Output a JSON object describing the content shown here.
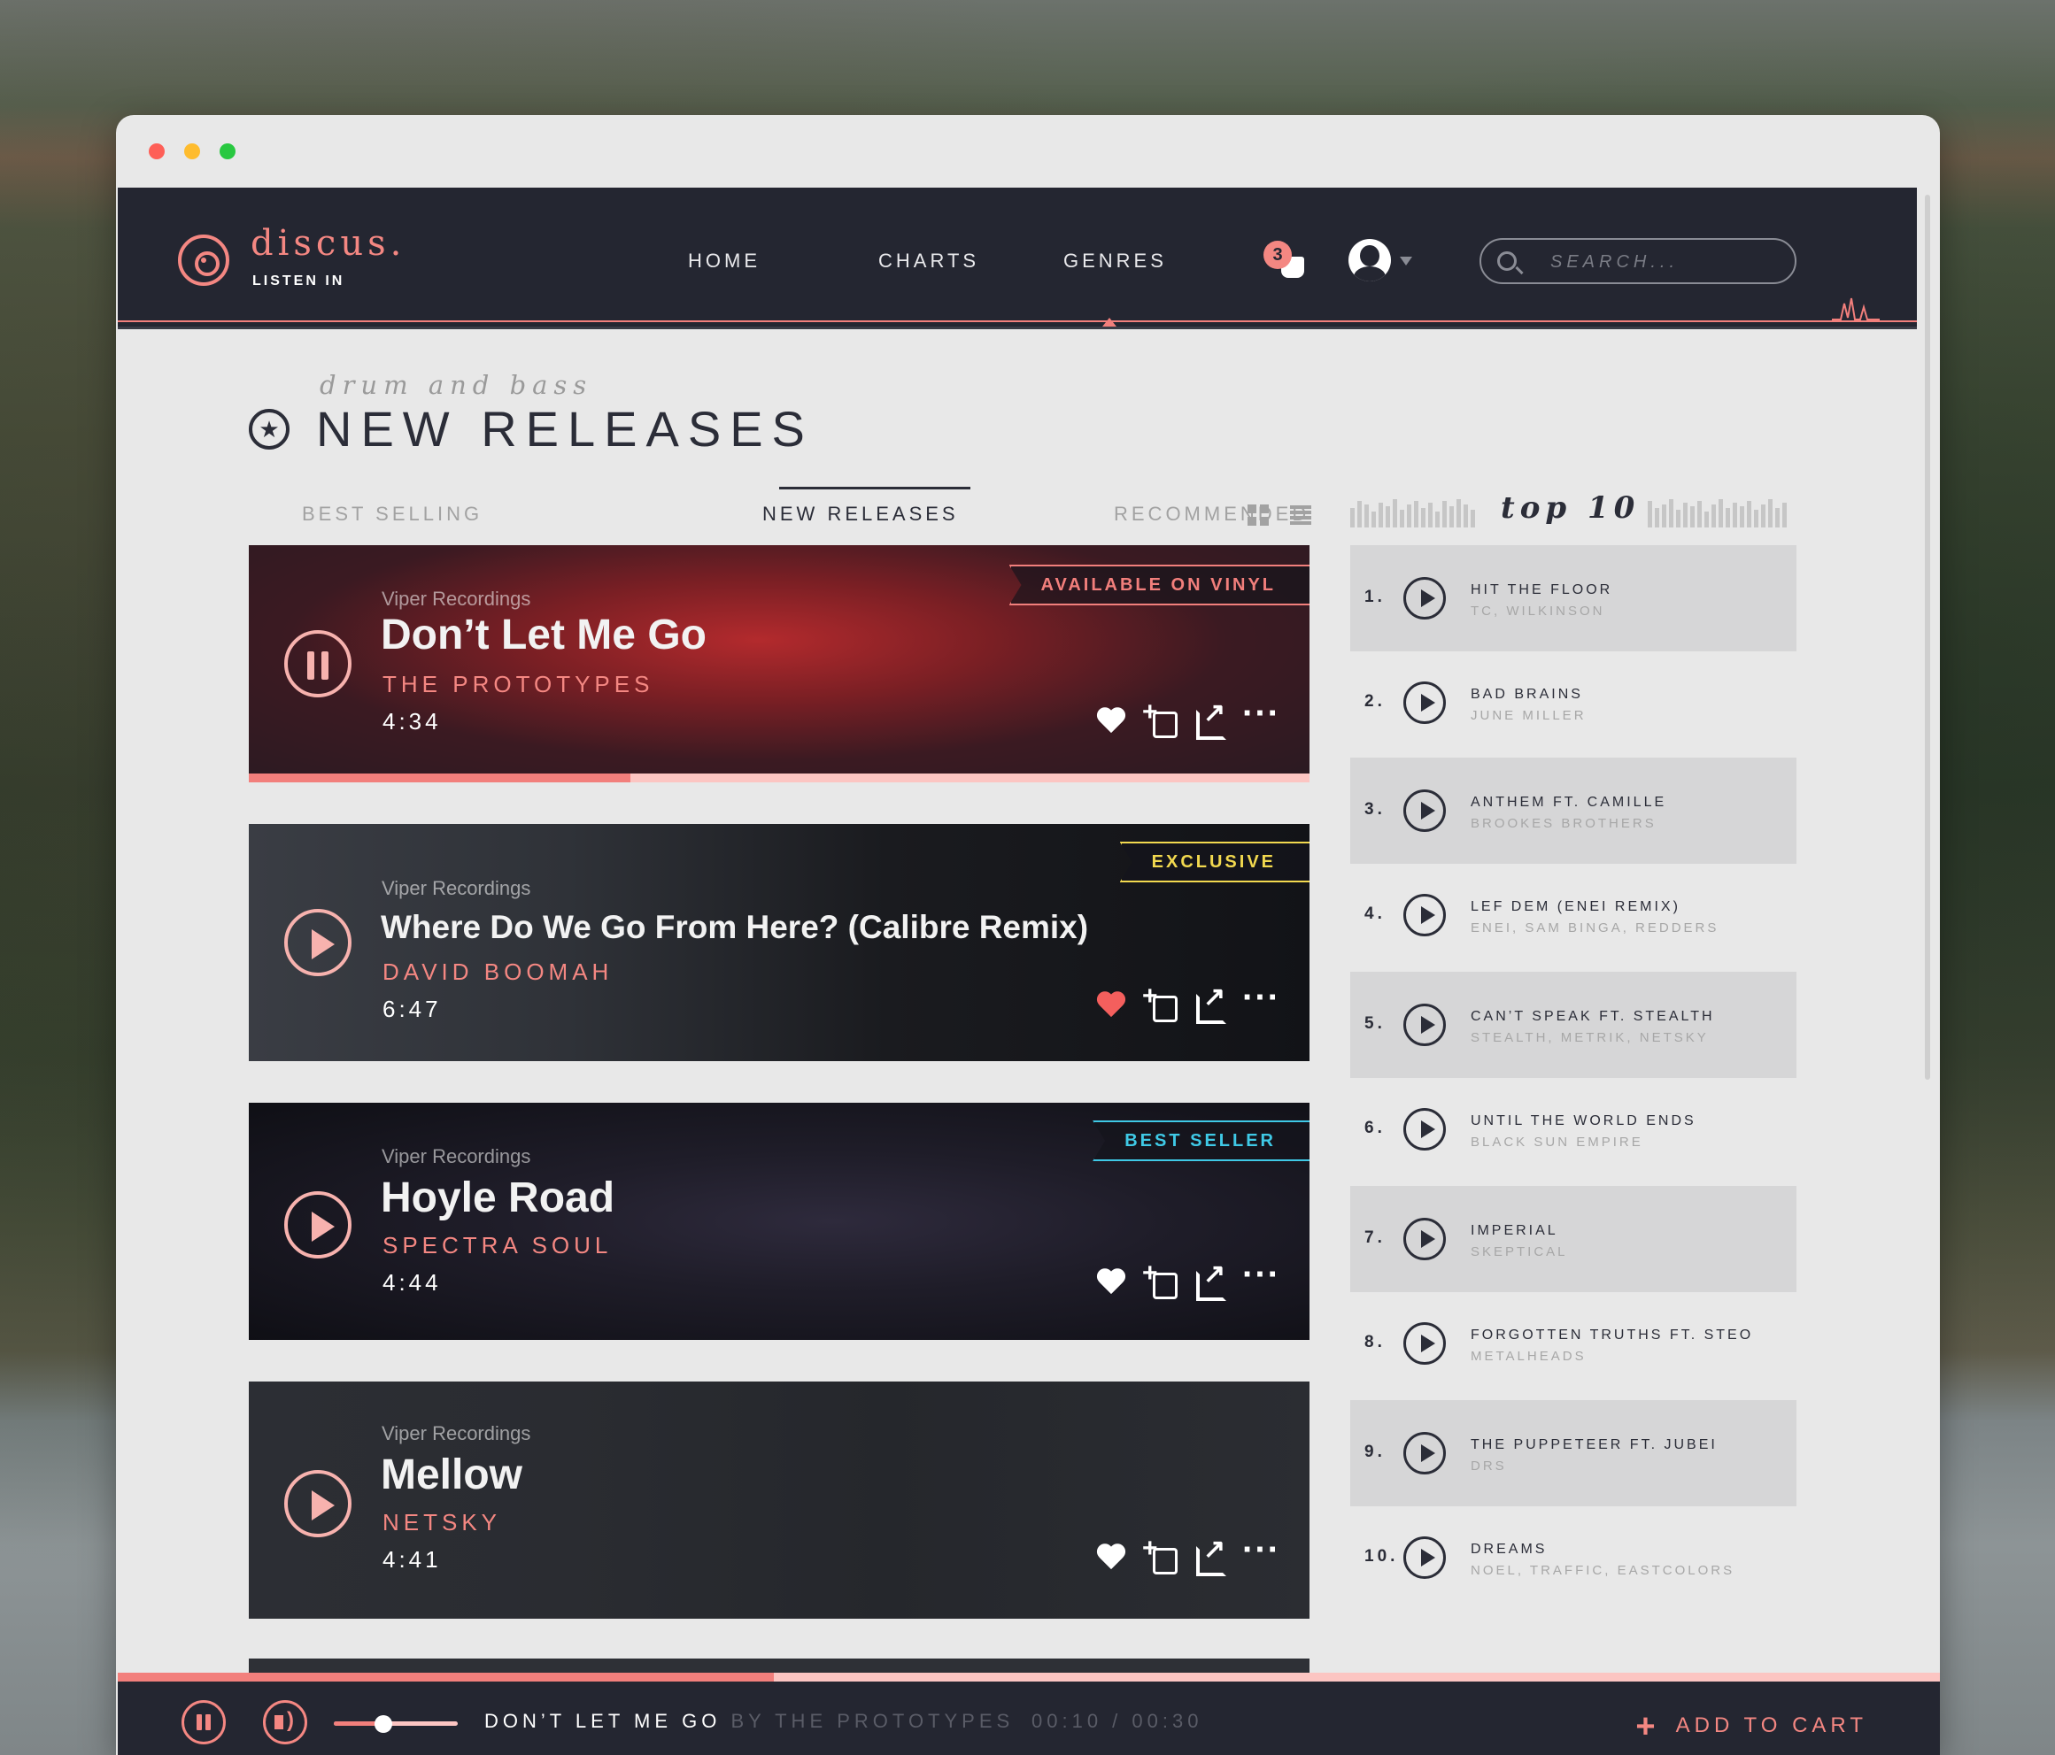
{
  "brand": {
    "name": "discus.",
    "tagline": "LISTEN IN",
    "accent": "#f48782",
    "dark": "#242631"
  },
  "nav": {
    "items": [
      "HOME",
      "CHARTS",
      "GENRES"
    ],
    "active": "GENRES"
  },
  "notifications": {
    "count": "3"
  },
  "search": {
    "placeholder": "SEARCH..."
  },
  "page": {
    "subtitle": "drum and bass",
    "title": "NEW RELEASES"
  },
  "tabs": [
    "BEST SELLING",
    "NEW RELEASES",
    "RECOMMENDED"
  ],
  "active_tab": "NEW RELEASES",
  "releases": [
    {
      "label": "Viper Recordings",
      "title": "Don’t Let Me Go",
      "artist": "THE PROTOTYPES",
      "duration": "4:34",
      "badge": "AVAILABLE ON VINYL",
      "badge_color": "#f27f7c",
      "playing": true,
      "liked": false,
      "progress": 0.36
    },
    {
      "label": "Viper Recordings",
      "title": "Where Do We Go From Here? (Calibre Remix)",
      "artist": "DAVID BOOMAH",
      "duration": "6:47",
      "badge": "EXCLUSIVE",
      "badge_color": "#f2d94f",
      "playing": false,
      "liked": true
    },
    {
      "label": "Viper Recordings",
      "title": "Hoyle Road",
      "artist": "SPECTRA SOUL",
      "duration": "4:44",
      "badge": "BEST SELLER",
      "badge_color": "#3fc9e6",
      "playing": false,
      "liked": false
    },
    {
      "label": "Viper Recordings",
      "title": "Mellow",
      "artist": "NETSKY",
      "duration": "4:41",
      "badge": "",
      "playing": false,
      "liked": false
    }
  ],
  "top10": {
    "title": "top 10",
    "items": [
      {
        "rank": "1.",
        "title": "HIT THE FLOOR",
        "artist": "TC, WILKINSON"
      },
      {
        "rank": "2.",
        "title": "BAD BRAINS",
        "artist": "JUNE MILLER"
      },
      {
        "rank": "3.",
        "title": "ANTHEM FT. CAMILLE",
        "artist": "BROOKES BROTHERS"
      },
      {
        "rank": "4.",
        "title": "LEF DEM (ENEI REMIX)",
        "artist": "ENEI, SAM BINGA, REDDERS"
      },
      {
        "rank": "5.",
        "title": "CAN’T SPEAK FT. STEALTH",
        "artist": "STEALTH, METRIK, NETSKY"
      },
      {
        "rank": "6.",
        "title": "UNTIL THE WORLD ENDS",
        "artist": "BLACK SUN EMPIRE"
      },
      {
        "rank": "7.",
        "title": "IMPERIAL",
        "artist": "SKEPTICAL"
      },
      {
        "rank": "8.",
        "title": "FORGOTTEN TRUTHS FT. STEO",
        "artist": "METALHEADS"
      },
      {
        "rank": "9.",
        "title": "THE PUPPETEER FT. JUBEI",
        "artist": "DRS"
      },
      {
        "rank": "10.",
        "title": "DREAMS",
        "artist": "NOEL, TRAFFIC, EASTCOLORS"
      }
    ]
  },
  "player": {
    "track": "DON’T LET ME GO",
    "by": "BY THE PROTOTYPES",
    "time": "00:10 / 00:30",
    "cart_label": "ADD TO CART",
    "progress": 0.36,
    "volume": 0.4
  }
}
